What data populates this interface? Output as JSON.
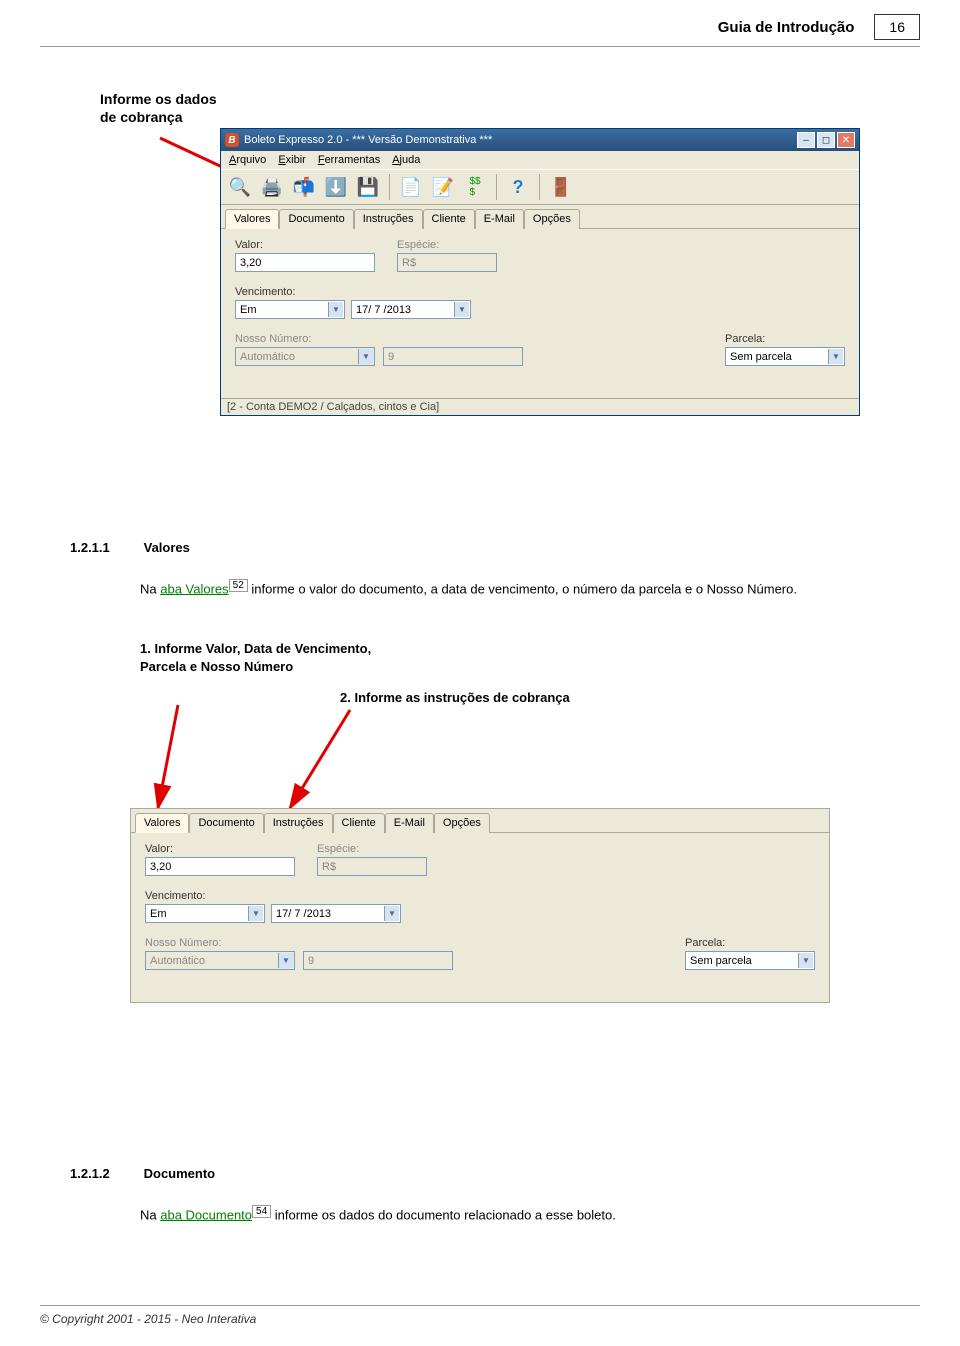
{
  "header": {
    "title": "Guia de Introdução",
    "page": "16"
  },
  "callout1": {
    "line1": "Informe os dados",
    "line2": "de cobrança"
  },
  "appwin": {
    "title": "Boleto Expresso 2.0 - *** Versão Demonstrativa ***",
    "menus": [
      "Arquivo",
      "Exibir",
      "Ferramentas",
      "Ajuda"
    ],
    "tabs": [
      "Valores",
      "Documento",
      "Instruções",
      "Cliente",
      "E-Mail",
      "Opções"
    ],
    "form": {
      "valor_label": "Valor:",
      "valor_value": "3,20",
      "especie_label": "Espécie:",
      "especie_value": "R$",
      "venc_label": "Vencimento:",
      "venc_mode": "Em",
      "venc_date": "17/ 7 /2013",
      "nosso_label": "Nosso Número:",
      "nosso_mode": "Automático",
      "nosso_value": "9",
      "parcela_label": "Parcela:",
      "parcela_value": "Sem parcela"
    },
    "status": "[2 - Conta DEMO2 / Calçados, cintos e Cia]"
  },
  "section1": {
    "num": "1.2.1.1",
    "title": "Valores",
    "prefix": "Na ",
    "link": "aba Valores",
    "ref": "52",
    "suffix": " informe o valor do documento, a data de vencimento, o número da parcela e o Nosso Número."
  },
  "callout2": {
    "a1": "1. Informe Valor, Data de Vencimento,",
    "a2": "Parcela e Nosso Número",
    "b": "2. Informe as instruções de cobrança"
  },
  "section2": {
    "num": "1.2.1.2",
    "title": "Documento",
    "prefix": "Na ",
    "link": "aba Documento",
    "ref": "54",
    "suffix": " informe os dados do documento relacionado a esse boleto."
  },
  "footer": "© Copyright 2001 - 2015 - Neo Interativa"
}
